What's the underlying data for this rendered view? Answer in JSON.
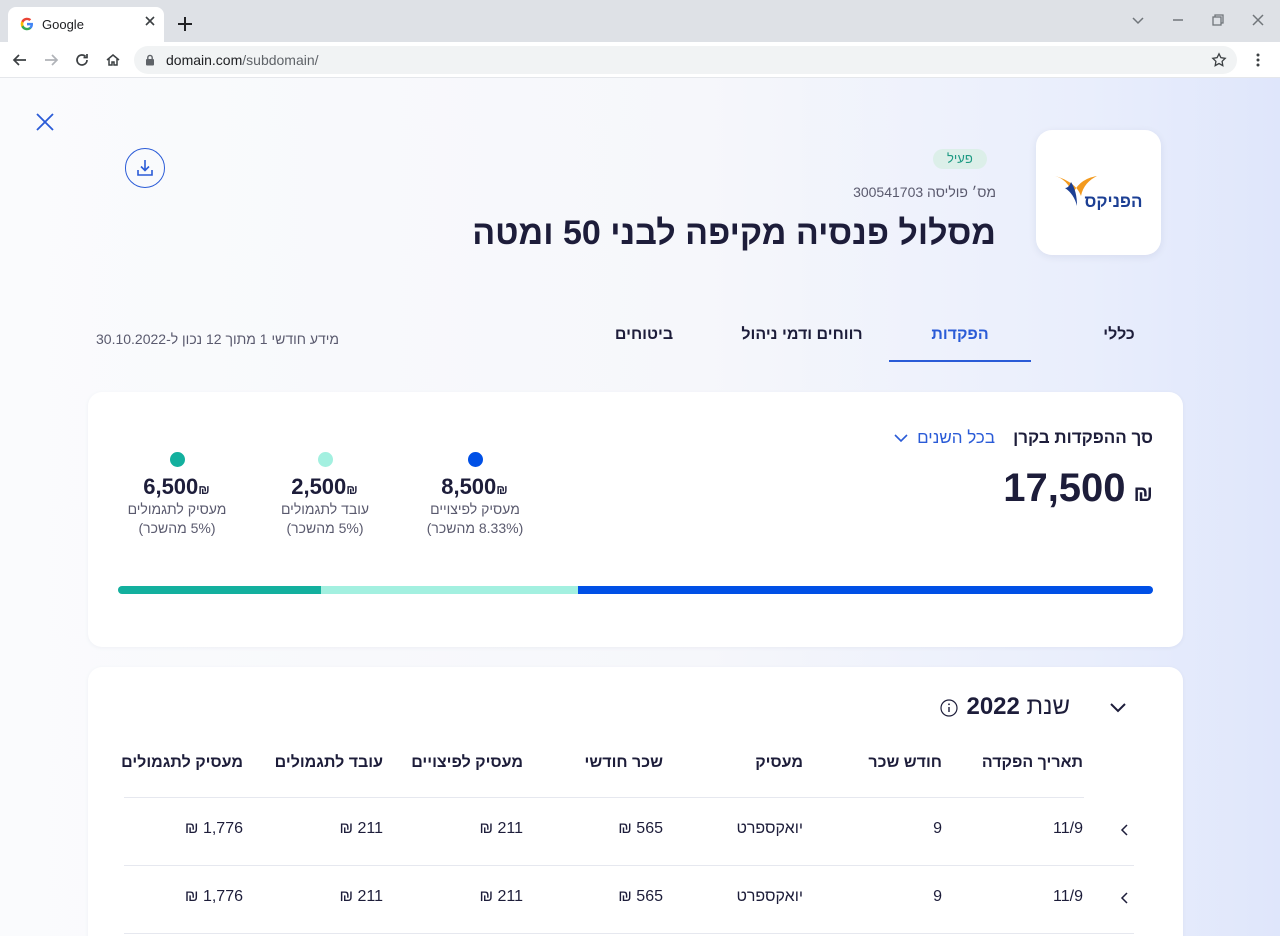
{
  "browser": {
    "tab_title": "Google",
    "url_host": "domain.com",
    "url_path": "/subdomain/"
  },
  "header": {
    "status": "פעיל",
    "policy_label": "מס׳ פוליסה",
    "policy_number": "300541703",
    "title": "מסלול פנסיה מקיפה לבני 50 ומטה",
    "company_logo_text": "הפניקס"
  },
  "tabs": [
    {
      "label": "כללי",
      "active": false
    },
    {
      "label": "הפקדות",
      "active": true
    },
    {
      "label": "רווחים ודמי ניהול",
      "active": false
    },
    {
      "label": "ביטוחים",
      "active": false
    }
  ],
  "info_line": "מידע חודשי 1 מתוך 12 נכון ל-30.10.2022",
  "summary": {
    "title": "סך ההפקדות בקרן",
    "period": "בכל השנים",
    "total": "17,500",
    "currency": "₪",
    "stats": [
      {
        "amount": "8,500",
        "label": "מעסיק לפיצויים",
        "sub": "(8.33% מהשכר)",
        "color": "#0050e6",
        "share": 0.5556
      },
      {
        "amount": "2,500",
        "label": "עובד לתגמולים",
        "sub": "(5% מהשכר)",
        "color": "#a3f0e0",
        "share": 0.2484
      },
      {
        "amount": "6,500",
        "label": "מעסיק לתגמולים",
        "sub": "(5% מהשכר)",
        "color": "#13b09e",
        "share": 0.196
      }
    ]
  },
  "table": {
    "year_label": "שנת",
    "year": "2022",
    "columns": [
      "תאריך הפקדה",
      "חודש שכר",
      "מעסיק",
      "שכר חודשי",
      "מעסיק לפיצויים",
      "עובד לתגמולים",
      "מעסיק לתגמולים"
    ],
    "rows": [
      [
        "11/9",
        "9",
        "יואקספרט",
        "565 ₪",
        "211 ₪",
        "211 ₪",
        "1,776 ₪"
      ],
      [
        "11/9",
        "9",
        "יואקספרט",
        "565 ₪",
        "211 ₪",
        "211 ₪",
        "1,776 ₪"
      ]
    ]
  }
}
